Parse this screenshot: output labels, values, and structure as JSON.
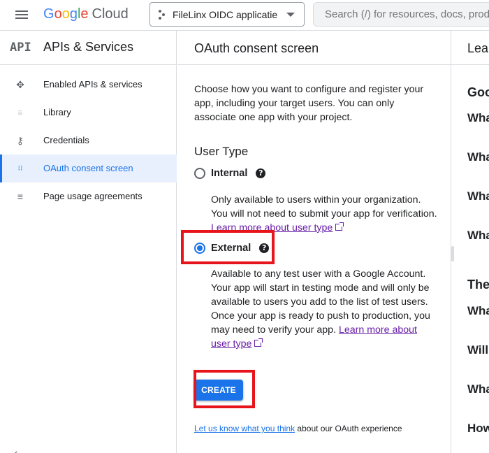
{
  "header": {
    "logo_letters": [
      "G",
      "o",
      "o",
      "g",
      "l",
      "e"
    ],
    "logo_product": "Cloud",
    "project_name": "FileLinx OIDC applicatie",
    "search_placeholder": "Search (/) for resources, docs, products, and more"
  },
  "sidebar": {
    "badge": "API",
    "title": "APIs & Services",
    "items": [
      {
        "label": "Enabled APIs & services",
        "icon": "apis-icon",
        "glyph": "✥"
      },
      {
        "label": "Library",
        "icon": "library-icon",
        "glyph": "⦙⦙⦙"
      },
      {
        "label": "Credentials",
        "icon": "key-icon",
        "glyph": "⚷"
      },
      {
        "label": "OAuth consent screen",
        "icon": "consent-icon",
        "glyph": "⁝⁝",
        "active": true
      },
      {
        "label": "Page usage agreements",
        "icon": "settings-list-icon",
        "glyph": "≡"
      }
    ],
    "collapse_glyph": "‹"
  },
  "main": {
    "title": "OAuth consent screen",
    "intro": "Choose how you want to configure and register your app, including your target users. You can only associate one app with your project.",
    "user_type_title": "User Type",
    "internal": {
      "label": "Internal",
      "desc": "Only available to users within your organization. You will not need to submit your app for verification.",
      "link": "Learn more about user type"
    },
    "external": {
      "label": "External",
      "desc": "Available to any test user with a Google Account. Your app will start in testing mode and will only be available to users you add to the list of test users. Once your app is ready to push to production, you may need to verify your app.",
      "link": "Learn more about user type"
    },
    "help_glyph": "?",
    "create_label": "CREATE",
    "feedback_link": "Let us know what you think",
    "feedback_text": " about our OAuth experience"
  },
  "help_panel": {
    "title": "Lear",
    "items": [
      "Goo",
      "Wha",
      "Wha",
      "Wha",
      "Wha",
      "The",
      "Wha",
      "Will",
      "Wha",
      "How"
    ]
  },
  "colors": {
    "accent": "#1a73e8",
    "link_visited": "#681da8",
    "highlight": "#e8141c"
  }
}
